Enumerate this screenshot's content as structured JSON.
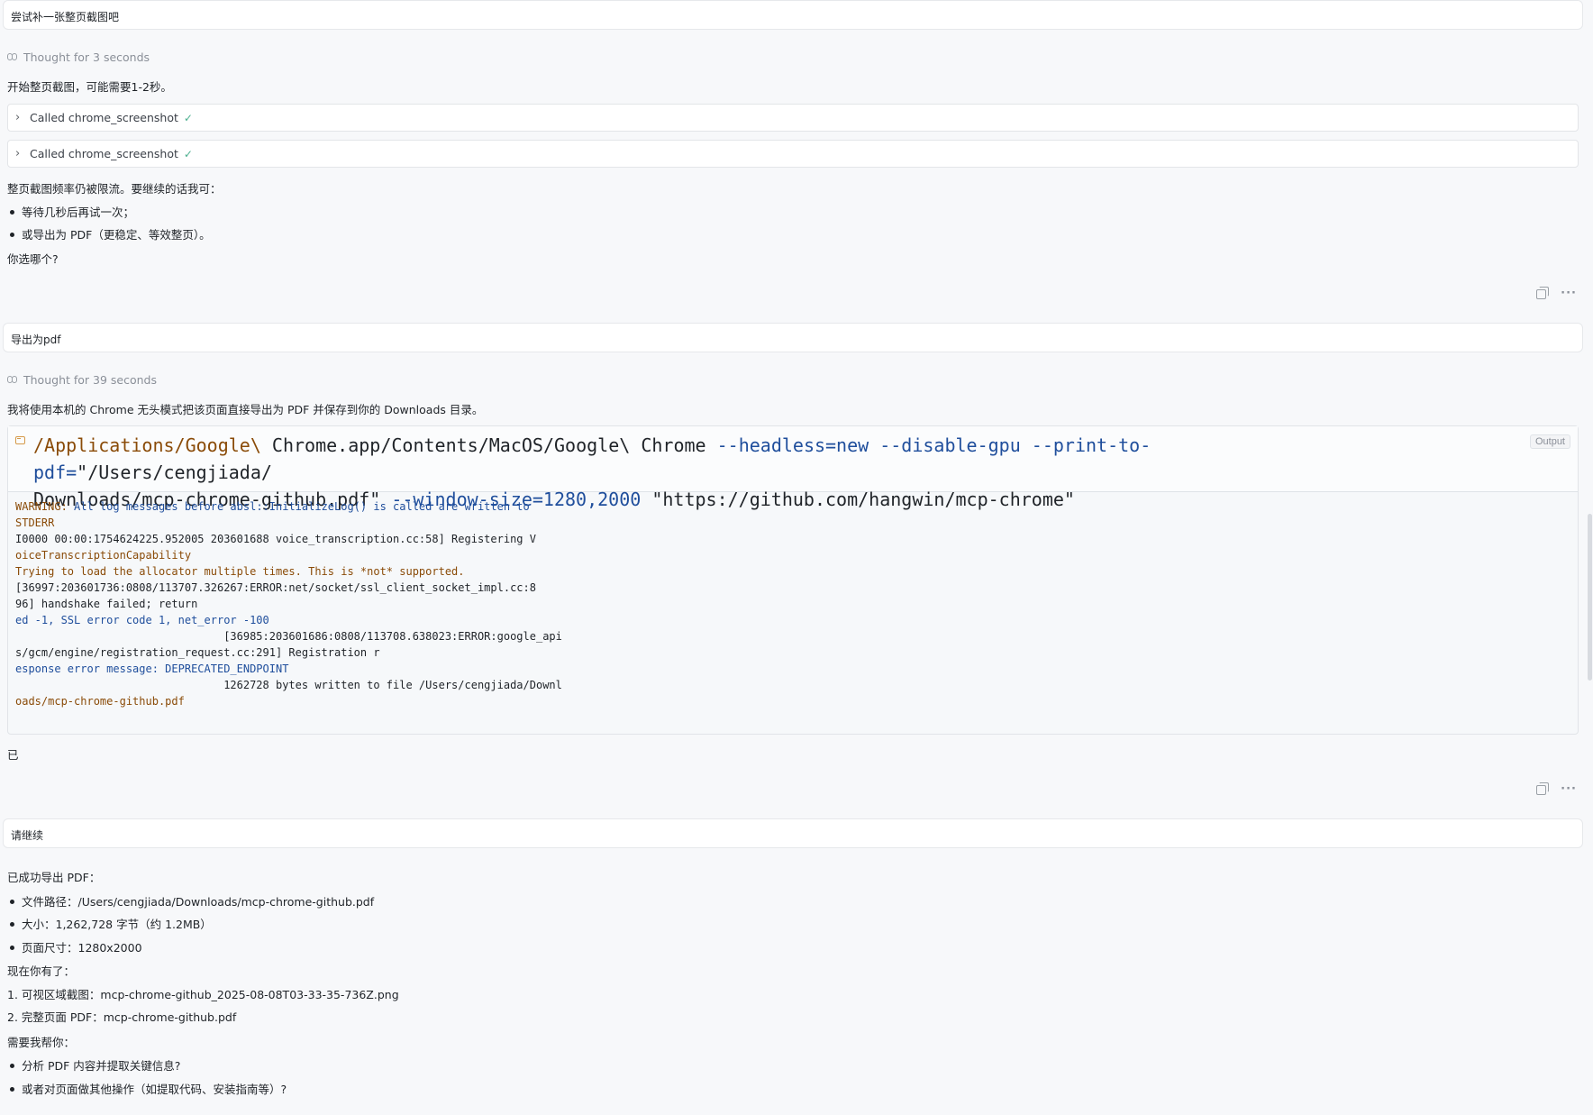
{
  "messages": {
    "user1": "尝试补一张整页截图吧",
    "thought1": "Thought for 3 seconds",
    "reply1_intro": "开始整页截图，可能需要1-2秒。",
    "tool1": "Called chrome_screenshot",
    "tool2": "Called chrome_screenshot",
    "reply1_p1": "整页截图频率仍被限流。要继续的话我可：",
    "reply1_b1": "等待几秒后再试一次；",
    "reply1_b2": "或导出为 PDF（更稳定、等效整页）。",
    "reply1_q": "你选哪个?",
    "user2": "导出为pdf",
    "thought2": "Thought for 39 seconds",
    "reply2_intro": "我将使用本机的 Chrome 无头模式把该页面直接导出为 PDF 并保存到你的 Downloads 目录。",
    "code": {
      "output_label": "Output",
      "cmd_path1": "/Applications/Google\\",
      "cmd_path2": " Chrome.app/Contents/MacOS/Google\\",
      "cmd_path3": " Chrome ",
      "cmd_flags1": "--headless=new --disable-gpu --print-to-pdf=",
      "cmd_out": "\"/Users/cengjiada/\nDownloads/mcp-chrome-github.pdf\"",
      "cmd_flags2": " --window-size=1280,2000",
      "cmd_url": " \"https://github.com/hangwin/mcp-chrome\"",
      "log": [
        "WARNING: All log messages before absl::InitializeLog() is called are written to",
        "STDERR",
        "I0000 00:00:1754624225.952005 203601688 voice_transcription.cc:58] Registering V",
        "oiceTranscriptionCapability",
        "Trying to load the allocator multiple times. This is *not* supported.",
        "[36997:203601736:0808/113707.326267:ERROR:net/socket/ssl_client_socket_impl.cc:8",
        "96] handshake failed; return",
        "ed -1, SSL error code 1, net_error -100",
        "                                [36985:203601686:0808/113708.638023:ERROR:google_api",
        "s/gcm/engine/registration_request.cc:291] Registration r",
        "esponse error message: DEPRECATED_ENDPOINT",
        "                                1262728 bytes written to file /Users/cengjiada/Downl",
        "oads/mcp-chrome-github.pdf"
      ]
    },
    "reply2_tail": "已",
    "user3": "请继续",
    "reply3_p1": "已成功导出 PDF：",
    "reply3_b1": "文件路径：/Users/cengjiada/Downloads/mcp-chrome-github.pdf",
    "reply3_b2": "大小：1,262,728 字节（约 1.2MB）",
    "reply3_b3": "页面尺寸：1280x2000",
    "reply3_p2": "现在你有了：",
    "reply3_n1": "1. 可视区域截图：mcp-chrome-github_2025-08-08T03-33-35-736Z.png",
    "reply3_n2": "2. 完整页面 PDF：mcp-chrome-github.pdf",
    "reply3_p3": "需要我帮你：",
    "reply3_b4": "分析 PDF 内容并提取关键信息?",
    "reply3_b5": "或者对页面做其他操作（如提取代码、安装指南等）?"
  },
  "icons": {
    "thought": "brain-icon",
    "expand": "chevron-right-icon",
    "success": "check-icon",
    "copy": "copy-icon",
    "more": "more-horizontal-icon",
    "terminal": "terminal-icon"
  },
  "colors": {
    "background": "#f7f8fa",
    "check": "#4caf8f",
    "code_path": "#8a4b08",
    "code_flag": "#1f4e9c"
  }
}
